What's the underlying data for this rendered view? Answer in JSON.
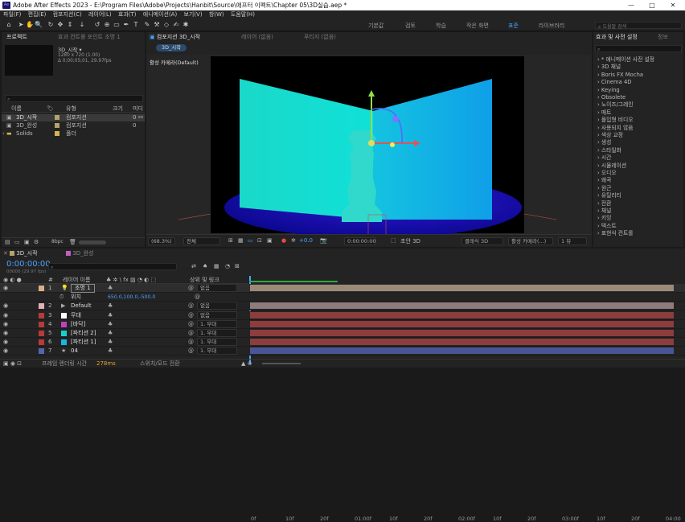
{
  "app": {
    "title": "Adobe After Effects 2023 - E:\\Program Files\\Adobe\\Projects\\Hanbit\\Source\\애프터 이펙트\\Chapter 05\\3D실습.aep *",
    "logo_text": "Ae"
  },
  "window_controls": {
    "minimize": "—",
    "maximize": "□",
    "close": "✕"
  },
  "menu": [
    "파일(F)",
    "편집(E)",
    "컴포지션(C)",
    "레이어(L)",
    "효과(T)",
    "애니메이션(A)",
    "보기(V)",
    "창(W)",
    "도움말(H)"
  ],
  "workspaces": [
    "기본값",
    "검토",
    "학습",
    "작은 화면",
    "표준",
    "라이브러리"
  ],
  "active_workspace": "표준",
  "search_help": {
    "placeholder": "도움말 검색"
  },
  "project": {
    "tab_label": "프로젝트",
    "effects_tab_label": "효과 컨트롤 포인트 조명 1",
    "preview": {
      "name": "3D_시작 ▾",
      "dims": "1280 x 720 (1.00)",
      "duration": "Δ 0;00;05;01, 29.97fps"
    },
    "columns": {
      "name": "이름",
      "type": "유형",
      "size": "크기",
      "media": "미디"
    },
    "items": [
      {
        "name": "3D_시작",
        "type": "컴포지션",
        "size": "0",
        "color": "#b6a36b",
        "icon": "composition-icon"
      },
      {
        "name": "3D_완성",
        "type": "컴포지션",
        "size": "0",
        "color": "#b6a36b",
        "icon": "composition-icon"
      },
      {
        "name": "Solids",
        "type": "폴더",
        "size": "",
        "color": "#d6b44a",
        "icon": "folder-icon"
      }
    ],
    "bpc": "8bpc"
  },
  "composition": {
    "tab_label": "컴포지션 3D_시작",
    "layer_tab": "레이어 (없음)",
    "footage_tab": "푸티지 (없음)",
    "breadcrumb": "3D_시작",
    "camera_label": "활성 카메라(Default)",
    "zoom": "(68.3%)",
    "resolution": "전체",
    "exposure": "+0.0",
    "timecode": "0:00:00:00",
    "renderer": "클래식 3D",
    "view": "활성 카메라(...)",
    "views": "1 뷰",
    "draft3d": "초안 3D"
  },
  "effects_panel": {
    "tab_label": "효과 및 사전 설정",
    "tab2": "정보",
    "search_placeholder": "",
    "items": [
      "* 애니메이션 사전 설정",
      "3D 채널",
      "Boris FX Mocha",
      "Cinema 4D",
      "Keying",
      "Obsolete",
      "노이즈/그레인",
      "매트",
      "몰입형 비디오",
      "사용되지 않음",
      "색상 교정",
      "생성",
      "스타일화",
      "시간",
      "시뮬레이션",
      "오디오",
      "왜곡",
      "원근",
      "유틸리티",
      "전환",
      "채널",
      "키잉",
      "텍스트",
      "표현식 컨트롤"
    ]
  },
  "timeline": {
    "tabs": [
      "3D_시작",
      "3D_완성"
    ],
    "timecode": "0:00:00:00",
    "timecode_sub": "00000 (29.97 fps)",
    "columns": {
      "name": "레이어 이름",
      "parent": "상위 및 링크"
    },
    "ruler": [
      "0f",
      "10f",
      "20f",
      "01:00f",
      "10f",
      "20f",
      "02:00f",
      "10f",
      "20f",
      "03:00f",
      "10f",
      "20f",
      "04:00"
    ],
    "layers": [
      {
        "num": "1",
        "name": "조명 1",
        "color": "#d7b08a",
        "parent": "없음",
        "icon": "light-icon",
        "bar": "#9c8a78",
        "selected": true
      },
      {
        "num": "",
        "name": "위치",
        "value": "650.0,100.0,-500.0",
        "is_property": true
      },
      {
        "num": "2",
        "name": "Default",
        "color": "#e0b2b6",
        "parent": "없음",
        "icon": "camera-icon",
        "bar": "#8f7a7c"
      },
      {
        "num": "3",
        "name": "무대",
        "color": "#b83a3a",
        "parent": "없음",
        "icon": "solid-icon",
        "bar": "#8d3d3d",
        "swatch": "#ffffff"
      },
      {
        "num": "4",
        "name": "[바닥]",
        "color": "#b83a3a",
        "parent": "1. 무대",
        "icon": "solid-icon",
        "bar": "#8d3d3d",
        "swatch": "#c040c0"
      },
      {
        "num": "5",
        "name": "[파티션 2]",
        "color": "#b83a3a",
        "parent": "1. 무대",
        "icon": "solid-icon",
        "bar": "#8d3d3d",
        "swatch": "#16d0d0"
      },
      {
        "num": "6",
        "name": "[파티션 1]",
        "color": "#b83a3a",
        "parent": "1. 무대",
        "icon": "solid-icon",
        "bar": "#8d3d3d",
        "swatch": "#16b8e0"
      },
      {
        "num": "7",
        "name": "04",
        "color": "#5566aa",
        "parent": "1. 무대",
        "icon": "shape-icon",
        "bar": "#4a5596"
      }
    ],
    "footer": "프레임 렌더링 시간",
    "render_time": "278ms",
    "toggle_label": "스위치/모드 전환"
  }
}
